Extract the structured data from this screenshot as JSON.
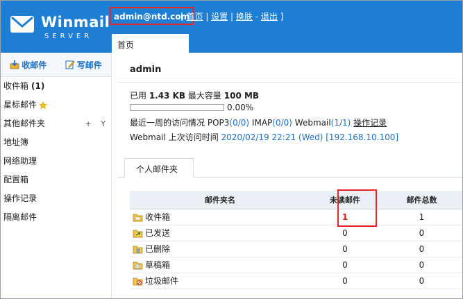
{
  "header": {
    "logo_text": "Winmail",
    "logo_sub": "SERVER",
    "account": "admin@ntd.com",
    "links": [
      "首页",
      "设置",
      "换肤",
      "退出"
    ],
    "active_tab": "首页"
  },
  "sidebar": {
    "receive_label": "收邮件",
    "compose_label": "写邮件",
    "items": [
      {
        "label": "收件箱",
        "count": "(1)"
      },
      {
        "label": "星标邮件"
      },
      {
        "label": "其他邮件夹",
        "tools": [
          "+",
          "Y"
        ]
      },
      {
        "label": "地址簿"
      },
      {
        "label": "网络助理"
      },
      {
        "label": "配置箱"
      },
      {
        "label": "操作记录"
      },
      {
        "label": "隔离邮件"
      }
    ]
  },
  "main": {
    "username": "admin",
    "usage": {
      "used_prefix": "已用",
      "used_value": "1.43 KB",
      "max_prefix": "最大容量",
      "max_value": "100 MB",
      "progress_fraction": 0.0,
      "percent": "0.00%"
    },
    "visits": {
      "prefix": "最近一周的访问情况",
      "pop3_label": "POP3",
      "pop3_value": "(0/0)",
      "imap_label": "IMAP",
      "imap_value": "(0/0)",
      "webmail_label": "Webmail",
      "webmail_value": "(1/1)",
      "log_link": "操作记录"
    },
    "last_visit": {
      "label": "Webmail 上次访问时间",
      "value": "2020/02/19 22:21 (Wed) [192.168.10.100]"
    },
    "subtab": "个人邮件夹",
    "table": {
      "headers": [
        "邮件夹名",
        "未读邮件",
        "邮件总数"
      ],
      "rows": [
        {
          "icon": "inbox-folder-icon",
          "name": "收件箱",
          "unread": "1",
          "total": "1"
        },
        {
          "icon": "sent-folder-icon",
          "name": "已发送",
          "unread": "0",
          "total": "0"
        },
        {
          "icon": "deleted-folder-icon",
          "name": "已删除",
          "unread": "0",
          "total": "0"
        },
        {
          "icon": "drafts-folder-icon",
          "name": "草稿箱",
          "unread": "0",
          "total": "0"
        },
        {
          "icon": "junk-folder-icon",
          "name": "垃圾邮件",
          "unread": "0",
          "total": "0"
        }
      ]
    }
  },
  "colors": {
    "header_blue": "#1e7ed3",
    "link_blue": "#1e6fc2",
    "highlight_red": "#e8262a",
    "unread_red": "#d81e1e"
  }
}
